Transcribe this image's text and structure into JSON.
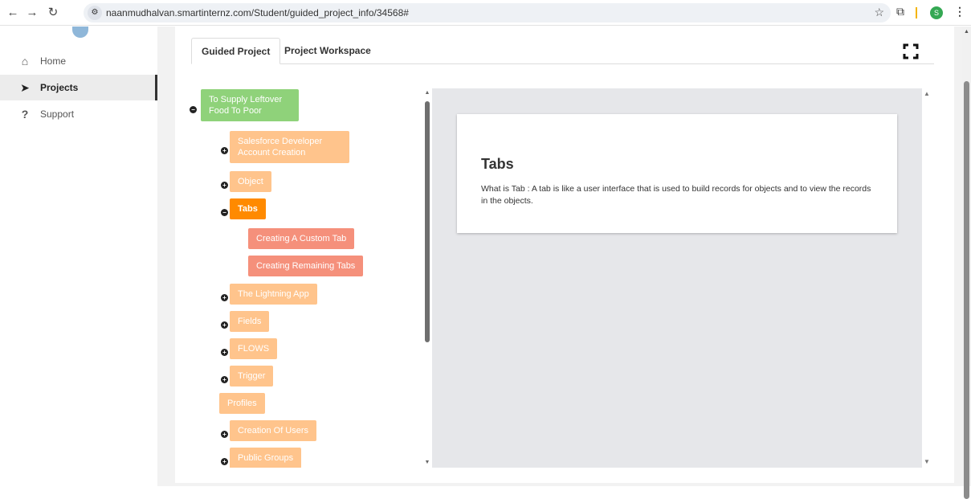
{
  "browser": {
    "url": "naanmudhalvan.smartinternz.com/Student/guided_project_info/34568#",
    "profile_initial": "S",
    "icons": [
      "back-icon",
      "forward-icon",
      "reload-icon",
      "site-info-icon",
      "star-icon",
      "extensions-icon",
      "menu-icon"
    ]
  },
  "sidebar": {
    "items": [
      {
        "label": "Home",
        "icon": "home-icon"
      },
      {
        "label": "Projects",
        "icon": "paper-plane-icon",
        "active": true
      },
      {
        "label": "Support",
        "icon": "question-icon"
      }
    ]
  },
  "tabs": [
    {
      "label": "Guided Project",
      "active": true
    },
    {
      "label": "Project Workspace",
      "active": false
    }
  ],
  "tree": {
    "root": "To Supply Leftover Food To Poor",
    "nodes": [
      {
        "label": "Salesforce Developer Account Creation",
        "toggle": "+"
      },
      {
        "label": "Object",
        "toggle": "+"
      },
      {
        "label": "Tabs",
        "toggle": "−",
        "selected": true
      },
      {
        "label": "Creating A Custom Tab"
      },
      {
        "label": "Creating Remaining Tabs"
      },
      {
        "label": "The Lightning App",
        "toggle": "+"
      },
      {
        "label": "Fields",
        "toggle": "+"
      },
      {
        "label": "FLOWS",
        "toggle": "+"
      },
      {
        "label": "Trigger",
        "toggle": "+"
      },
      {
        "label": "Profiles"
      },
      {
        "label": "Creation Of Users",
        "toggle": "+"
      },
      {
        "label": "Public Groups",
        "toggle": "+"
      }
    ]
  },
  "content": {
    "title": "Tabs",
    "body": "What is Tab : A tab is like a user interface that is used to build records for objects and to view the records in the objects."
  },
  "colors": {
    "root_node": "#8fd27a",
    "node": "#ffc48c",
    "selected_node": "#ff8a00",
    "child_node": "#f5907b",
    "content_bg": "#e6e7ea"
  }
}
